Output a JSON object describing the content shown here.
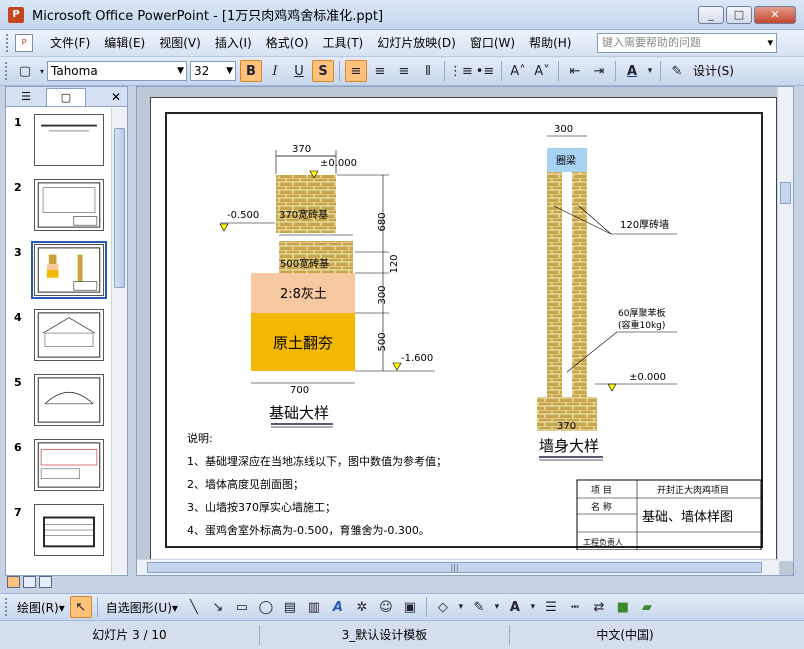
{
  "window": {
    "title": "Microsoft Office PowerPoint - [1万只肉鸡鸡舍标准化.ppt]",
    "min": "_",
    "max": "□",
    "close": "✕"
  },
  "menu": {
    "items": [
      "文件(F)",
      "编辑(E)",
      "视图(V)",
      "插入(I)",
      "格式(O)",
      "工具(T)",
      "幻灯片放映(D)",
      "窗口(W)",
      "帮助(H)"
    ],
    "help_placeholder": "键入需要帮助的问题"
  },
  "format_toolbar": {
    "font": "Tahoma",
    "size": "32",
    "bold": "B",
    "italic": "I",
    "underline": "U",
    "shadow": "S",
    "design": "设计(S)"
  },
  "panel": {
    "tab1": "☰",
    "tab2": "▢",
    "close": "✕"
  },
  "slides": [
    {
      "num": "1"
    },
    {
      "num": "2"
    },
    {
      "num": "3"
    },
    {
      "num": "4"
    },
    {
      "num": "5"
    },
    {
      "num": "6"
    },
    {
      "num": "7"
    }
  ],
  "slide": {
    "dim_370_top": "370",
    "pm0_left": "±0.000",
    "neg500": "-0.500",
    "label_370wall": "370宽砖基",
    "label_500wall": "500宽砖基",
    "dim_680": "680",
    "dim_120_left": "120",
    "label_lime": "2:8灰土",
    "label_rammed": "原土翻夯",
    "dim_300_left": "300",
    "dim_500": "500",
    "neg1600": "-1.600",
    "dim_700": "700",
    "title_foundation": "基础大样",
    "dim_300_right": "300",
    "label_beam": "圈梁",
    "label_120wall": "120厚砖墙",
    "label_board1": "60厚聚苯板",
    "label_board2": "(容重10kg)",
    "pm0_right": "±0.000",
    "dim_370_bottom": "370",
    "title_wall": "墙身大样",
    "notes_title": "说明:",
    "notes": [
      "1、基础埋深应在当地冻线以下，图中数值为参考值；",
      "2、墙体高度见剖面图；",
      "3、山墙按370厚实心墙施工；",
      "4、蛋鸡舍室外标高为-0.500，育雏舍为-0.300。"
    ],
    "table": {
      "k1": "项 目",
      "v1": "开封正大肉鸡项目",
      "k2": "名 称",
      "v2": "基础、墙体样图",
      "k3": "工程负责人"
    }
  },
  "draw_toolbar": {
    "draw": "绘图(R)▾",
    "autoshapes": "自选图形(U)▾"
  },
  "status": {
    "slide_info": "幻灯片 3 / 10",
    "template": "3_默认设计模板",
    "language": "中文(中国)"
  }
}
